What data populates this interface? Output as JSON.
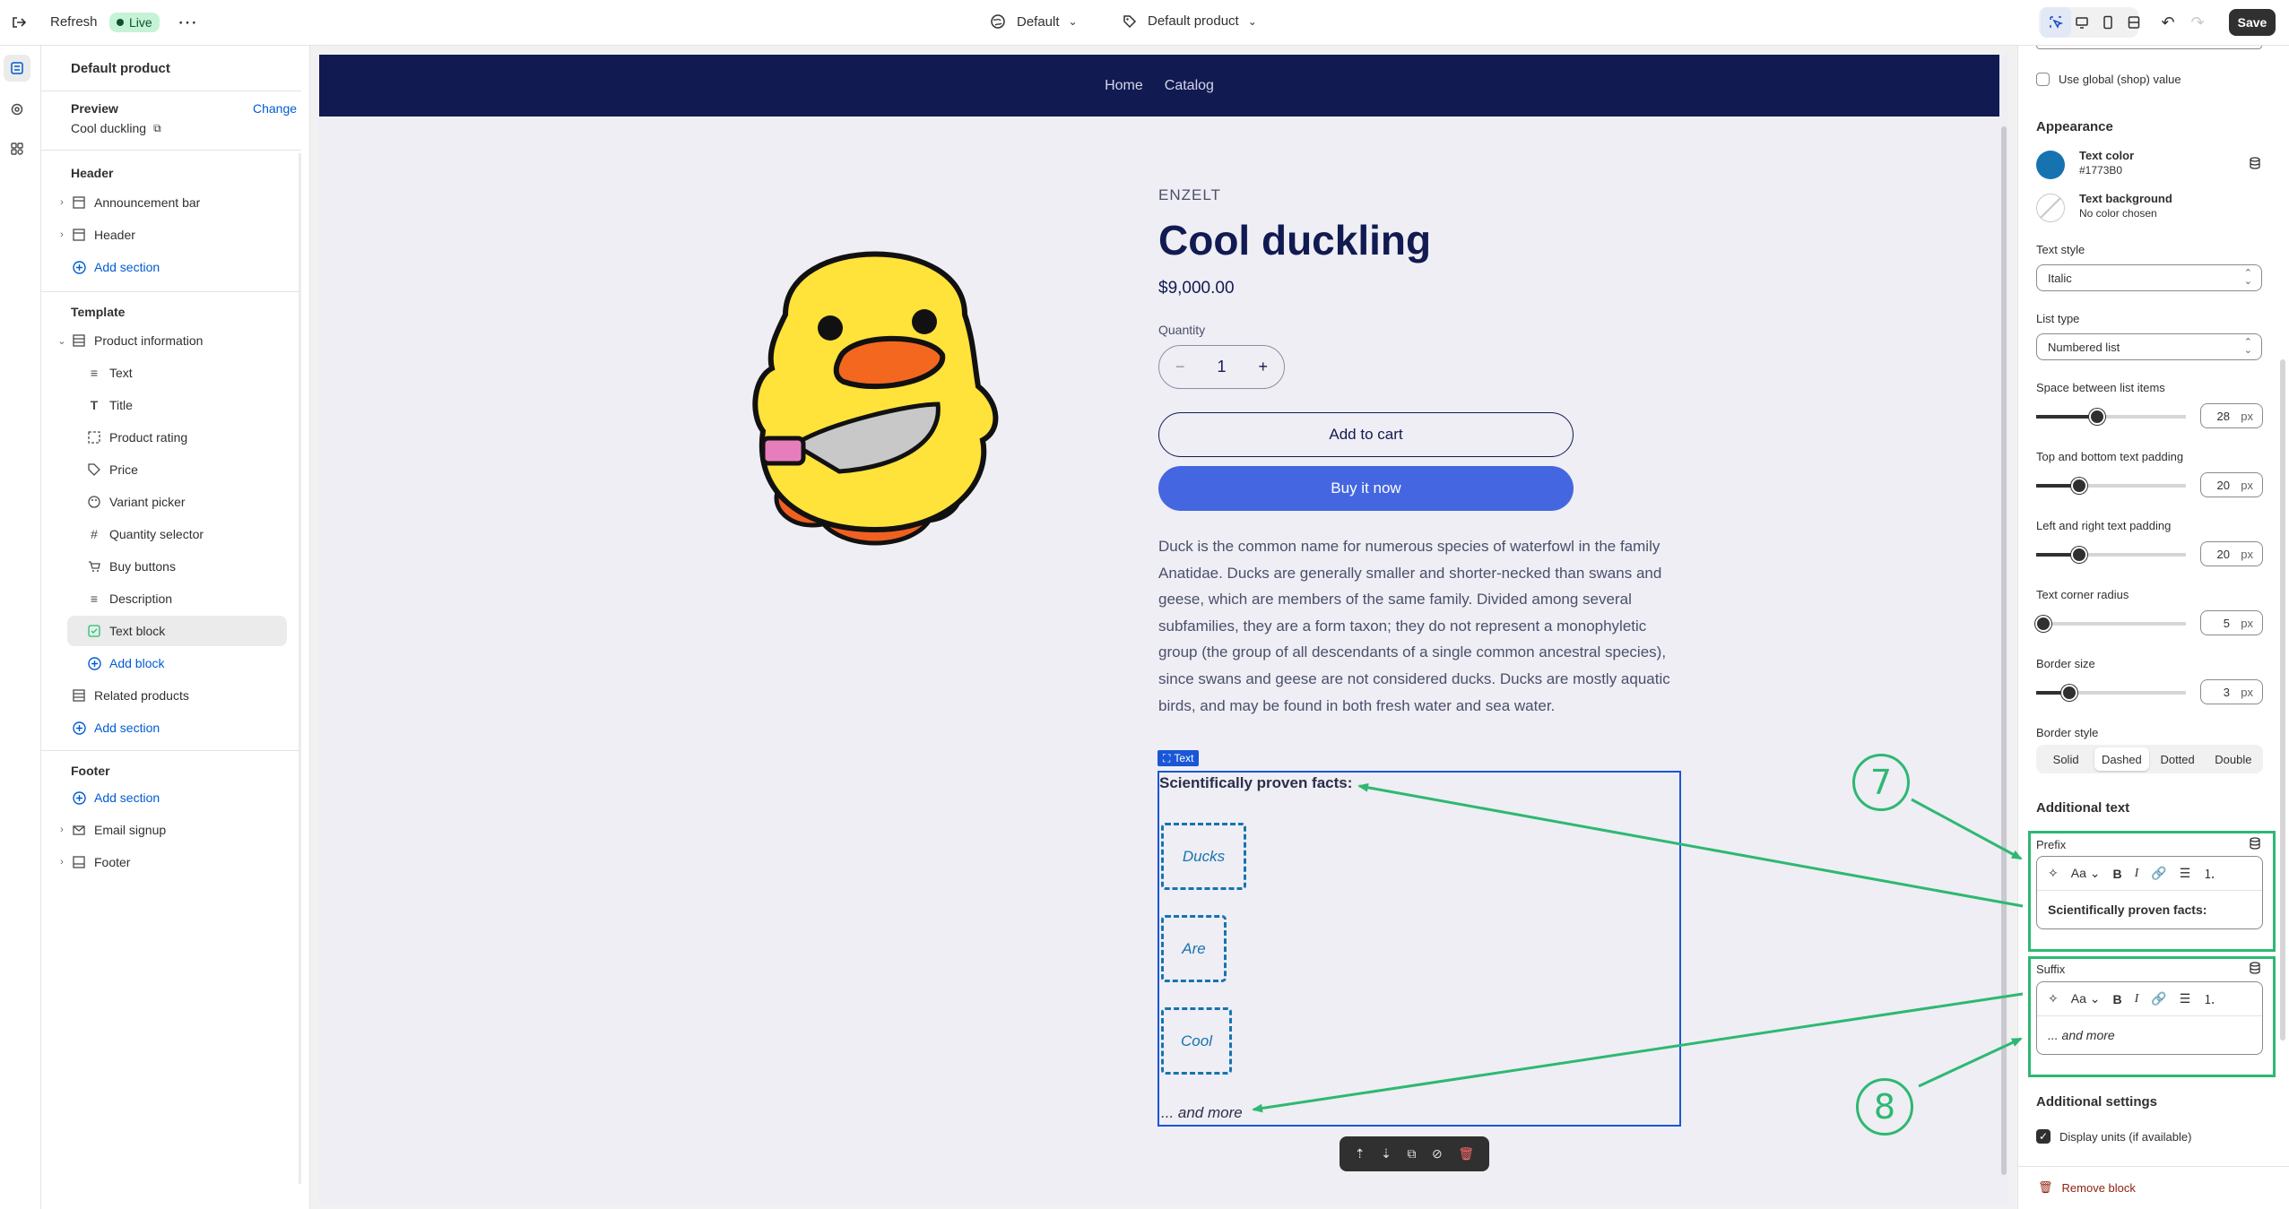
{
  "topbar": {
    "refresh_label": "Refresh",
    "live_badge": "Live",
    "theme_label": "Default",
    "template_label": "Default product",
    "save_label": "Save"
  },
  "left_panel": {
    "title": "Default product",
    "preview_label": "Preview",
    "change_link": "Change",
    "preview_product": "Cool duckling",
    "header_section": "Header",
    "header_items": [
      "Announcement bar",
      "Header"
    ],
    "add_section": "Add section",
    "template_section": "Template",
    "product_information": "Product information",
    "blocks": [
      "Text",
      "Title",
      "Product rating",
      "Price",
      "Variant picker",
      "Quantity selector",
      "Buy buttons",
      "Description",
      "Text block"
    ],
    "add_block": "Add block",
    "related_products": "Related products",
    "footer_section": "Footer",
    "footer_items": [
      "Email signup",
      "Footer"
    ]
  },
  "store": {
    "nav": [
      "Home",
      "Catalog"
    ],
    "vendor": "ENZELT",
    "product_title": "Cool duckling",
    "price": "$9,000.00",
    "quantity_label": "Quantity",
    "quantity_value": "1",
    "add_to_cart": "Add to cart",
    "buy_now": "Buy it now",
    "description": "Duck is the common name for numerous species of waterfowl in the family Anatidae. Ducks are generally smaller and shorter-necked than swans and geese, which are members of the same family. Divided among several subfamilies, they are a form taxon; they do not represent a monophyletic group (the group of all descendants of a single common ancestral species), since swans and geese are not considered ducks. Ducks are mostly aquatic birds, and may be found in both fresh water and sea water.",
    "text_block_tag": "Text",
    "prefix_text": "Scientifically proven facts:",
    "list_items": [
      "Ducks",
      "Are",
      "Cool"
    ],
    "suffix_text": "... and more"
  },
  "right_panel": {
    "use_global": "Use global (shop) value",
    "appearance": "Appearance",
    "text_color_label": "Text color",
    "text_color_value": "#1773B0",
    "text_bg_label": "Text background",
    "text_bg_value": "No color chosen",
    "text_style_label": "Text style",
    "text_style_value": "Italic",
    "list_type_label": "List type",
    "list_type_value": "Numbered list",
    "sliders": [
      {
        "label": "Space between list items",
        "value": "28",
        "unit": "px",
        "level": 0.41
      },
      {
        "label": "Top and bottom text padding",
        "value": "20",
        "unit": "px",
        "level": 0.29
      },
      {
        "label": "Left and right text padding",
        "value": "20",
        "unit": "px",
        "level": 0.29
      },
      {
        "label": "Text corner radius",
        "value": "5",
        "unit": "px",
        "level": 0.05
      },
      {
        "label": "Border size",
        "value": "3",
        "unit": "px",
        "level": 0.22
      }
    ],
    "border_style_label": "Border style",
    "border_styles": [
      "Solid",
      "Dashed",
      "Dotted",
      "Double"
    ],
    "border_style_selected": "Dashed",
    "additional_text": "Additional text",
    "prefix_label": "Prefix",
    "prefix_value": "Scientifically proven facts:",
    "suffix_label": "Suffix",
    "suffix_value": "... and more",
    "additional_settings": "Additional settings",
    "display_units": "Display units (if available)",
    "remove_block": "Remove block"
  },
  "annotations": {
    "seven": "7",
    "eight": "8"
  },
  "colors": {
    "accent_green": "#2eb872",
    "store_nav": "#121a52",
    "buy_button": "#4466e0",
    "text_color": "#1773B0",
    "live_green": "#c6f3d6"
  }
}
